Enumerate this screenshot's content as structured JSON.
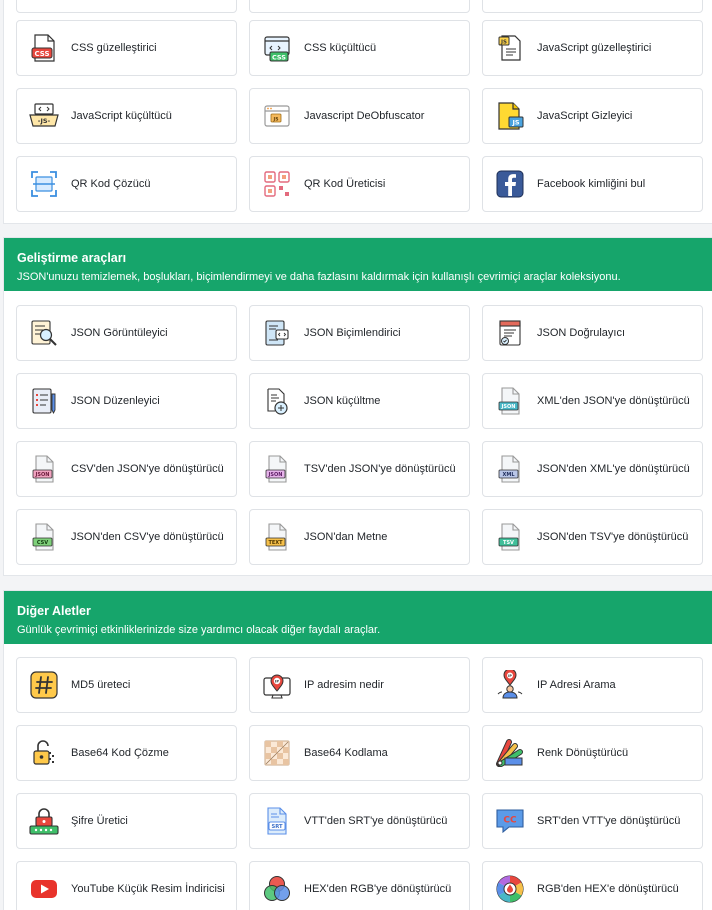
{
  "sections": [
    {
      "id": "top",
      "rows": [
        [
          "CSS güzelleştirici",
          "CSS küçültücü",
          "JavaScript güzelleştirici"
        ],
        [
          "JavaScript küçültücü",
          "Javascript DeObfuscator",
          "JavaScript Gizleyici"
        ],
        [
          "QR Kod Çözücü",
          "QR Kod Üreticisi",
          "Facebook kimliğini bul"
        ]
      ]
    },
    {
      "id": "dev",
      "title": "Geliştirme araçları",
      "desc": "JSON'unuzu temizlemek, boşlukları, biçimlendirmeyi ve daha fazlasını kaldırmak için kullanışlı çevrimiçi araçlar koleksiyonu.",
      "rows": [
        [
          "JSON Görüntüleyici",
          "JSON Biçimlendirici",
          "JSON Doğrulayıcı"
        ],
        [
          "JSON Düzenleyici",
          "JSON küçültme",
          "XML'den JSON'ye dönüştürücü"
        ],
        [
          "CSV'den JSON'ye dönüştürücü",
          "TSV'den JSON'ye dönüştürücü",
          "JSON'den XML'ye dönüştürücü"
        ],
        [
          "JSON'den CSV'ye dönüştürücü",
          "JSON'dan Metne",
          "JSON'den TSV'ye dönüştürücü"
        ]
      ]
    },
    {
      "id": "other",
      "title": "Diğer Aletler",
      "desc": "Günlük çevrimiçi etkinliklerinizde size yardımcı olacak diğer faydalı araçlar.",
      "rows": [
        [
          "MD5 üreteci",
          "IP adresim nedir",
          "IP Adresi Arama"
        ],
        [
          "Base64 Kod Çözme",
          "Base64 Kodlama",
          "Renk Dönüştürücü"
        ],
        [
          "Şifre Üretici",
          "VTT'den SRT'ye dönüştürücü",
          "SRT'den VTT'ye dönüştürücü"
        ],
        [
          "YouTube Küçük Resim İndiricisi",
          "HEX'den RGB'ye dönüştürücü",
          "RGB'den HEX'e dönüştürücü"
        ]
      ]
    }
  ],
  "file_badges": {
    "xml_to_json": "JSON",
    "csv_to_json": "JSON",
    "tsv_to_json": "JSON",
    "json_to_xml": "XML",
    "json_to_csv": "CSV",
    "json_to_text": "TEXT",
    "json_to_tsv": "TSV",
    "css": "CSS",
    "js_min": "-JS-",
    "srt": "SRT",
    "cc": "CC"
  },
  "colors": {
    "header_green": "#16a56b",
    "card_border": "#dfe2e6"
  }
}
